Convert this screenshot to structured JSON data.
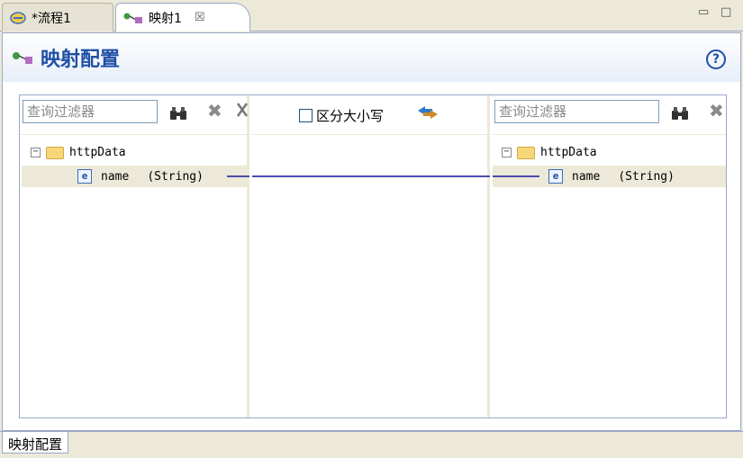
{
  "tabs": [
    {
      "label": "*流程1",
      "icon": "process-icon"
    },
    {
      "label": "映射1",
      "icon": "mapping-icon",
      "close": "☒"
    }
  ],
  "window_controls": {
    "minimize": "▭",
    "maximize": "□"
  },
  "header": {
    "title": "映射配置",
    "help": "?"
  },
  "left": {
    "filter_placeholder": "查询过滤器",
    "root": "httpData",
    "item": {
      "name": "name",
      "type": "(String)",
      "icon_letter": "e"
    }
  },
  "middle": {
    "case_label": "区分大小写"
  },
  "right": {
    "filter_placeholder": "查询过滤器",
    "root": "httpData",
    "item": {
      "name": "name",
      "type": "(String)",
      "icon_letter": "e"
    }
  },
  "bottom_tabs": [
    {
      "label": "映射配置"
    }
  ],
  "colors": {
    "accent": "#1f4fa6",
    "mapping_line": "#4b4bb0",
    "selected_row": "#ece9d8"
  }
}
